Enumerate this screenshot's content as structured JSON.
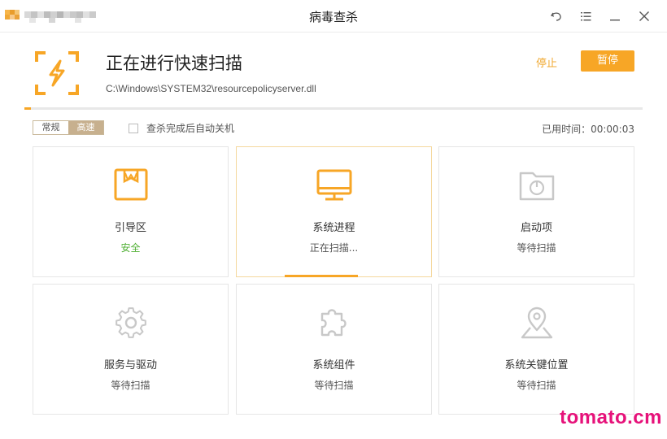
{
  "window": {
    "title": "病毒查杀"
  },
  "header": {
    "title": "正在进行快速扫描",
    "path": "C:\\Windows\\SYSTEM32\\resourcepolicyserver.dll",
    "stop_label": "停止",
    "pause_label": "暂停",
    "progress_fraction": 0.01
  },
  "options": {
    "mode_normal": "常规",
    "mode_fast": "高速",
    "selected_mode": "高速",
    "auto_shutdown_label": "查杀完成后自动关机",
    "auto_shutdown_checked": false,
    "elapsed_label": "已用时间：",
    "elapsed_value": "00:00:03"
  },
  "cards": [
    {
      "name": "引导区",
      "status": "安全",
      "icon": "boot-sector-icon"
    },
    {
      "name": "系统进程",
      "status": "正在扫描...",
      "icon": "monitor-icon"
    },
    {
      "name": "启动项",
      "status": "等待扫描",
      "icon": "startup-folder-icon"
    },
    {
      "name": "服务与驱动",
      "status": "等待扫描",
      "icon": "gear-icon"
    },
    {
      "name": "系统组件",
      "status": "等待扫描",
      "icon": "puzzle-icon"
    },
    {
      "name": "系统关键位置",
      "status": "等待扫描",
      "icon": "location-pin-icon"
    }
  ],
  "colors": {
    "accent": "#f7a626",
    "safe": "#52b036",
    "inactive_icon": "#c8c8c8"
  },
  "watermark": "tomato.cm"
}
